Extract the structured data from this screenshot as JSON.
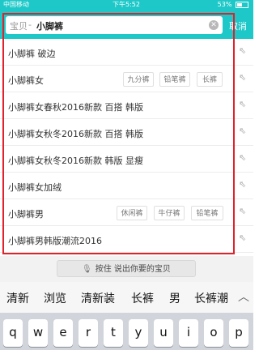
{
  "status_bar": {
    "carrier": "中国移动",
    "time": "下午5:52",
    "battery": "53%"
  },
  "search": {
    "prefix": "宝贝",
    "separator": "-",
    "query": "小脚裤",
    "cancel_label": "取消"
  },
  "suggestions": [
    {
      "text": "小脚裤 破边",
      "chips": []
    },
    {
      "text": "小脚裤女",
      "chips": [
        "九分裤",
        "铅笔裤",
        "长裤"
      ]
    },
    {
      "text": "小脚裤女春秋2016新款 百搭 韩版",
      "chips": []
    },
    {
      "text": "小脚裤女秋冬2016新款 百搭 韩版",
      "chips": []
    },
    {
      "text": "小脚裤女秋冬2016新款 韩版 显瘦",
      "chips": []
    },
    {
      "text": "小脚裤女加绒",
      "chips": []
    },
    {
      "text": "小脚裤男",
      "chips": [
        "休闲裤",
        "牛仔裤",
        "铅笔裤"
      ]
    },
    {
      "text": "小脚裤男韩版潮流2016",
      "chips": []
    }
  ],
  "voice": {
    "label": "按住  说出你要的宝贝"
  },
  "ime": {
    "candidates": [
      "清新",
      "浏览",
      "清新装",
      "长裤",
      "男",
      "长裤潮"
    ]
  },
  "keyboard": {
    "keys": [
      "q",
      "w",
      "e",
      "r",
      "t",
      "y",
      "u",
      "i",
      "o",
      "p"
    ]
  },
  "colors": {
    "header_bg": "#1ec8c8",
    "highlight_border": "#e0222a"
  }
}
